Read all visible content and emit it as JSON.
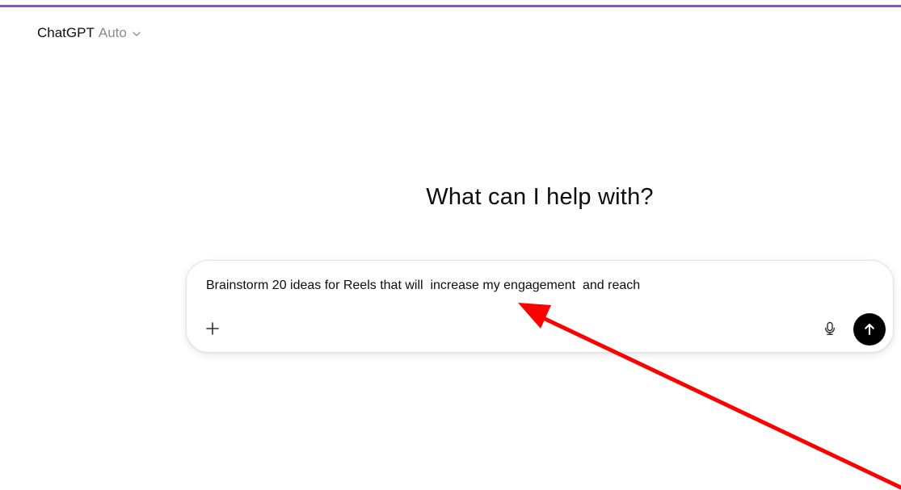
{
  "header": {
    "app_name": "ChatGPT",
    "model_name": "Auto",
    "chevron_icon": "chevron-down-icon"
  },
  "main": {
    "title": "What can I help with?"
  },
  "composer": {
    "prompt_value": "Brainstorm 20 ideas for Reels that will  increase my engagement  and reach",
    "icons": {
      "add": "plus-icon",
      "voice": "microphone-icon",
      "send": "arrow-up-icon"
    }
  },
  "annotation": {
    "shape": "red-arrow",
    "points_to": "prompt text",
    "color": "#ff0000"
  },
  "colors": {
    "top_accent": "#7b5fae",
    "send_button": "#000000",
    "muted_text": "#8a8a8a"
  }
}
